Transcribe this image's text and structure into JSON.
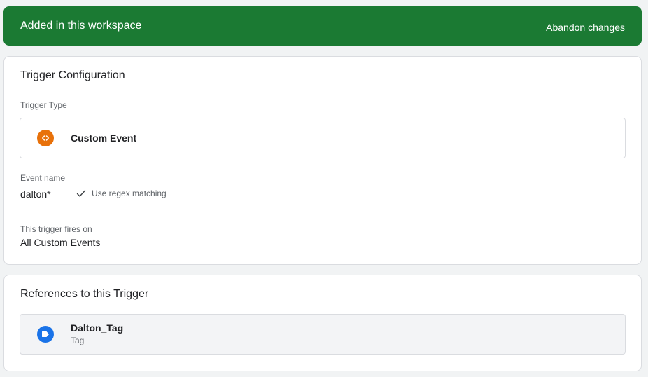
{
  "banner": {
    "title": "Added in this workspace",
    "action_label": "Abandon changes",
    "color": "#1b7a33"
  },
  "config": {
    "title": "Trigger Configuration",
    "trigger_type_label": "Trigger Type",
    "trigger_type": {
      "name": "Custom Event",
      "icon": "code-brackets-icon",
      "icon_color": "#e8710a"
    },
    "event_name_label": "Event name",
    "event_name_value": "dalton*",
    "regex": {
      "checked": true,
      "label": "Use regex matching"
    },
    "fires_on_label": "This trigger fires on",
    "fires_on_value": "All Custom Events"
  },
  "references": {
    "title": "References to this Trigger",
    "items": [
      {
        "name": "Dalton_Tag",
        "type": "Tag",
        "icon": "tag-icon",
        "icon_color": "#1a73e8"
      }
    ]
  }
}
